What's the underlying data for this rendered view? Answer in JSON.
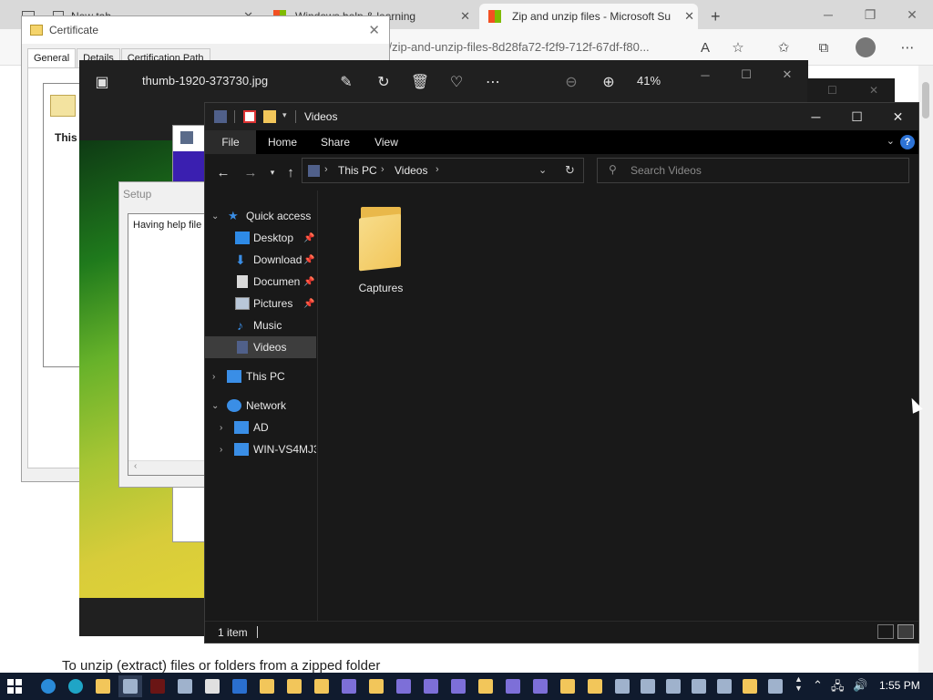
{
  "browser": {
    "tabs": [
      {
        "label": "New tab"
      },
      {
        "label": "Windows help & learning"
      },
      {
        "label": "Zip and unzip files - Microsoft Su"
      }
    ],
    "new_tab_symbol": "+",
    "url_partial": "s/zip-and-unzip-files-8d28fa72-f2f9-712f-67df-f80...",
    "content_footer_text": "To unzip (extract) files or folders from a zipped folder"
  },
  "certificate": {
    "title": "Certificate",
    "tabs": [
      "General",
      "Details",
      "Certification Path"
    ],
    "bold_text": "This c"
  },
  "photos": {
    "filename": "thumb-1920-373730.jpg",
    "zoom": "41%"
  },
  "setup": {
    "title": "Setup",
    "text": "Having help file"
  },
  "explorer": {
    "title": "Videos",
    "ribbon_tabs": [
      "File",
      "Home",
      "Share",
      "View"
    ],
    "help_label": "?",
    "breadcrumb": [
      "This PC",
      "Videos"
    ],
    "search_placeholder": "Search Videos",
    "nav": {
      "quick_access": "Quick access",
      "items": [
        "Desktop",
        "Download",
        "Documen",
        "Pictures",
        "Music",
        "Videos"
      ],
      "this_pc": "This PC",
      "network": "Network",
      "network_items": [
        "AD",
        "WIN-VS4MJ3"
      ]
    },
    "files": [
      {
        "name": "Captures",
        "type": "folder"
      }
    ],
    "status": "1 item"
  },
  "taskbar": {
    "clock": "1:55 PM"
  },
  "colors": {
    "explorer_bg": "#191919",
    "folder": "#f2c65a",
    "help_blue": "#2d73d6",
    "taskbar": "#101b2e"
  }
}
